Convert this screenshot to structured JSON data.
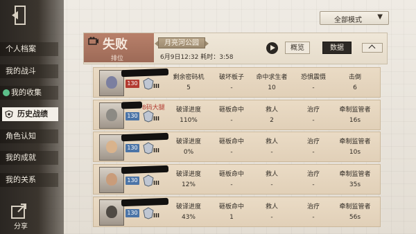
{
  "sidebar": {
    "items": [
      {
        "label": "个人档案",
        "active": false
      },
      {
        "label": "我的战斗",
        "active": false
      },
      {
        "label": "我的收集",
        "active": false,
        "dot": true
      },
      {
        "label": "历史战绩",
        "active": true
      },
      {
        "label": "角色认知",
        "active": false
      },
      {
        "label": "我的成就",
        "active": false
      },
      {
        "label": "我的关系",
        "active": false
      }
    ],
    "share_label": "分享",
    "icons": {
      "exit": "exit-icon",
      "share": "share-icon",
      "history": "history-icon"
    }
  },
  "mode_select": {
    "value": "全部模式",
    "icon": "chevron-down-icon"
  },
  "match": {
    "result": "失败",
    "mode": "排位",
    "map": "月亮河公园",
    "date_time": "6月9日12:32 耗时：3:58",
    "tabs": [
      {
        "label": "概览",
        "selected": false
      },
      {
        "label": "数据",
        "selected": true
      }
    ],
    "icons": {
      "camera": "camera-icon",
      "play": "play-icon",
      "collapse": "chevron-up-icon"
    }
  },
  "rows": [
    {
      "level": "130",
      "level_color": "#b23a30",
      "rank_sub": "III",
      "name_visible": "",
      "stats": [
        {
          "label": "剩余密码机",
          "value": "5"
        },
        {
          "label": "破坏板子",
          "value": "-"
        },
        {
          "label": "命中求生者",
          "value": "10"
        },
        {
          "label": "恐惧震慑",
          "value": "-"
        },
        {
          "label": "击倒",
          "value": "6"
        }
      ]
    },
    {
      "level": "130",
      "level_color": "#4b74a7",
      "rank_sub": "III",
      "name_visible": "8码大腿",
      "stats": [
        {
          "label": "破译进度",
          "value": "110%"
        },
        {
          "label": "砸板命中",
          "value": "-"
        },
        {
          "label": "救人",
          "value": "2"
        },
        {
          "label": "治疗",
          "value": "-"
        },
        {
          "label": "牵制监管者",
          "value": "16s"
        }
      ]
    },
    {
      "level": "130",
      "level_color": "#4b74a7",
      "rank_sub": "III",
      "name_visible": "",
      "stats": [
        {
          "label": "破译进度",
          "value": "0%"
        },
        {
          "label": "砸板命中",
          "value": "-"
        },
        {
          "label": "救人",
          "value": "-"
        },
        {
          "label": "治疗",
          "value": "-"
        },
        {
          "label": "牵制监管者",
          "value": "10s"
        }
      ]
    },
    {
      "level": "130",
      "level_color": "#4b74a7",
      "rank_sub": "III",
      "name_visible": "",
      "stats": [
        {
          "label": "破译进度",
          "value": "12%"
        },
        {
          "label": "砸板命中",
          "value": "-"
        },
        {
          "label": "救人",
          "value": "-"
        },
        {
          "label": "治疗",
          "value": "-"
        },
        {
          "label": "牵制监管者",
          "value": "35s"
        }
      ]
    },
    {
      "level": "130",
      "level_color": "#4b74a7",
      "rank_sub": "III",
      "name_visible": "",
      "stats": [
        {
          "label": "破译进度",
          "value": "43%"
        },
        {
          "label": "砸板命中",
          "value": "1"
        },
        {
          "label": "救人",
          "value": "-"
        },
        {
          "label": "治疗",
          "value": "-"
        },
        {
          "label": "牵制监管者",
          "value": "56s"
        }
      ]
    }
  ]
}
